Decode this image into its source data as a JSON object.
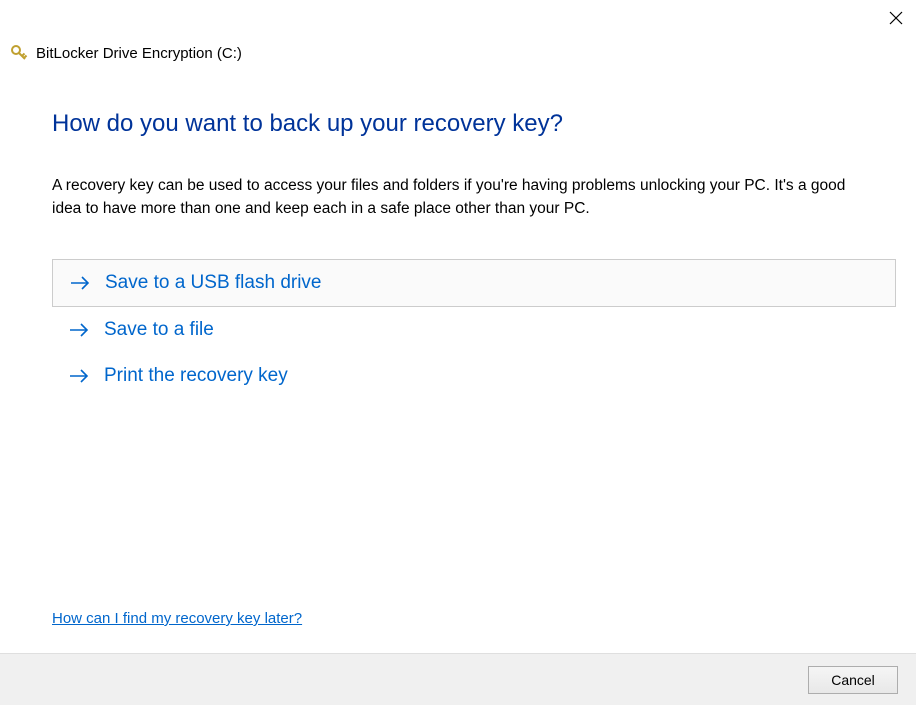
{
  "window": {
    "title": "BitLocker Drive Encryption (C:)"
  },
  "main": {
    "heading": "How do you want to back up your recovery key?",
    "description": "A recovery key can be used to access your files and folders if you're having problems unlocking your PC. It's a good idea to have more than one and keep each in a safe place other than your PC."
  },
  "options": [
    {
      "label": "Save to a USB flash drive",
      "selected": true
    },
    {
      "label": "Save to a file",
      "selected": false
    },
    {
      "label": "Print the recovery key",
      "selected": false
    }
  ],
  "help_link": "How can I find my recovery key later?",
  "footer": {
    "cancel": "Cancel"
  },
  "colors": {
    "heading": "#003399",
    "link": "#0066cc",
    "footer_bg": "#f0f0f0"
  }
}
